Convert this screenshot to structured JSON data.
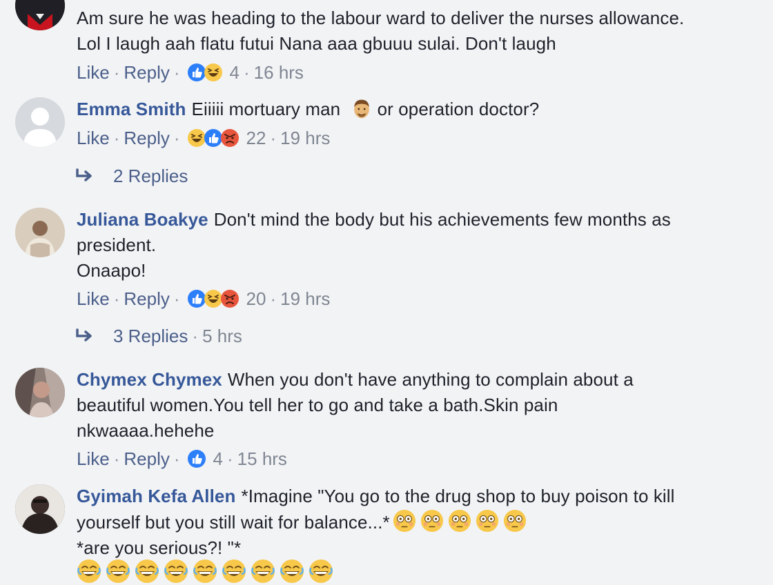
{
  "comments": [
    {
      "author": "",
      "lines": [
        "Am sure he was heading to the labour ward to deliver the nurses allowance.",
        "Lol I laugh aah flatu futui Nana aaa gbuuu sulai. Don't laugh"
      ],
      "like": "Like",
      "reply": "Reply",
      "reactions": [
        "like",
        "haha"
      ],
      "count": "4",
      "time": "16 hrs"
    },
    {
      "author": "Emma Smith",
      "text_before_emoji": "Eiiiii mortuary man",
      "text_after_emoji": "or operation doctor?",
      "inline_emoji": "man-face-emoji",
      "like": "Like",
      "reply": "Reply",
      "reactions": [
        "haha",
        "like",
        "angry"
      ],
      "count": "22",
      "time": "19 hrs",
      "replies": "2 Replies"
    },
    {
      "author": "Juliana Boakye",
      "line1": "Don't mind the body but his achievements few months as",
      "line2": "president.",
      "line3": "Onaapo!",
      "like": "Like",
      "reply": "Reply",
      "reactions": [
        "like",
        "haha",
        "angry"
      ],
      "count": "20",
      "time": "19 hrs",
      "replies": "3 Replies",
      "replies_time": "5 hrs"
    },
    {
      "author": "Chymex Chymex",
      "line1": "When you don't have anything to complain about a",
      "line2": "beautiful women.You tell her to go and take a bath.Skin pain",
      "line3": "nkwaaaa.hehehe",
      "like": "Like",
      "reply": "Reply",
      "reactions": [
        "like"
      ],
      "count": "4",
      "time": "15 hrs"
    },
    {
      "author": "Gyimah Kefa Allen",
      "line1": "*Imagine \"You go to the drug shop to buy poison to kill",
      "line2": "yourself but you still wait for balance...*",
      "line3": "*are you serious?! \"*",
      "flushed_emoji_count": 5,
      "laughing_emoji_count": 9
    }
  ],
  "separator": "·",
  "colors": {
    "author": "#365899",
    "action": "#4b5f8a",
    "meta": "#7f8692",
    "like_blue": "#2d7ff9",
    "haha_yellow": "#f7c84a",
    "angry_red": "#e8553d",
    "background": "#f2f3f5"
  }
}
